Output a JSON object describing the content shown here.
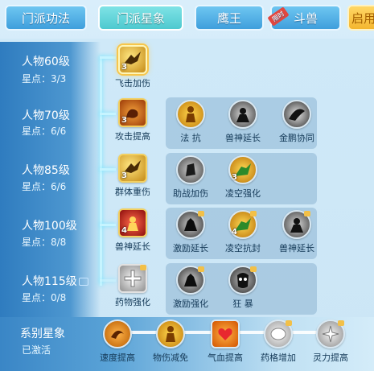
{
  "tabs": [
    {
      "label": "门派功法",
      "active": false
    },
    {
      "label": "门派星象",
      "active": true
    },
    {
      "label": "鹰王",
      "active": false
    },
    {
      "label": "斗兽",
      "active": false,
      "ribbon": "限时"
    },
    {
      "label": "启用",
      "active": false
    }
  ],
  "rows": [
    {
      "level": "人物60级",
      "stars": "星点：3/3",
      "skills": [
        {
          "name": "飞击加伤",
          "icon": "eagle-icon",
          "level": "3"
        }
      ]
    },
    {
      "level": "人物70级",
      "stars": "星点：6/6",
      "skills": [
        {
          "name": "攻击提高",
          "icon": "muscle-icon",
          "level": "3"
        },
        {
          "name": "法 抗",
          "icon": "gold-figure-icon"
        },
        {
          "name": "兽神延长",
          "icon": "beast-god-icon"
        },
        {
          "name": "金鹏协同",
          "icon": "golden-roc-icon"
        }
      ]
    },
    {
      "level": "人物85级",
      "stars": "星点：6/6",
      "skills": [
        {
          "name": "群体重伤",
          "icon": "eagle-icon",
          "level": "3"
        },
        {
          "name": "助战加伤",
          "icon": "fist-icon"
        },
        {
          "name": "凌空强化",
          "icon": "green-warrior-icon",
          "level": "3"
        }
      ]
    },
    {
      "level": "人物100级",
      "stars": "星点：8/8",
      "skills": [
        {
          "name": "兽神延长",
          "icon": "beast-rage-icon",
          "level": "4"
        },
        {
          "name": "激励延长",
          "icon": "dark-figure-icon"
        },
        {
          "name": "凌空抗封",
          "icon": "green-warrior-icon",
          "level": "4"
        },
        {
          "name": "兽神延长",
          "icon": "beast-god-icon"
        }
      ]
    },
    {
      "level": "人物115级",
      "stars": "星点：0/8",
      "skills": [
        {
          "name": "药物强化",
          "icon": "potion-plus-icon"
        },
        {
          "name": "激励强化",
          "icon": "dark-figure-icon"
        },
        {
          "name": "狂 暴",
          "icon": "berserk-mask-icon"
        }
      ]
    }
  ],
  "system": {
    "title": "系别星象",
    "status": "已激活",
    "items": [
      {
        "name": "速度提高",
        "icon": "speed-swirl-icon"
      },
      {
        "name": "物伤减免",
        "icon": "gold-figure-icon"
      },
      {
        "name": "气血提高",
        "icon": "heart-icon"
      },
      {
        "name": "药格增加",
        "icon": "potion-slot-icon"
      },
      {
        "name": "灵力提高",
        "icon": "spirit-burst-icon"
      }
    ]
  }
}
